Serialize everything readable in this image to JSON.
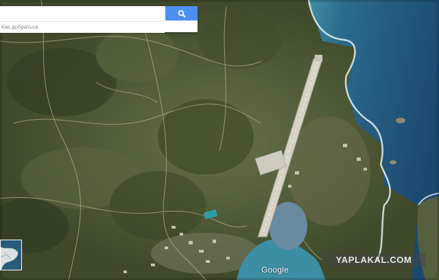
{
  "search": {
    "query": "",
    "directions_label": "Как добраться",
    "button_icon": "search-icon"
  },
  "map": {
    "view": "satellite",
    "thumbnail_view": "map-thumbnail",
    "logo_text": "Google"
  },
  "watermark": {
    "text": "YAPLAKAL.COM"
  },
  "colors": {
    "search_button": "#4d8ef2",
    "sea_deep": "#1f4f75",
    "sea_shallow": "#4f9fb2",
    "terrain": "#4b5634",
    "runway": "#d7d4c8"
  }
}
